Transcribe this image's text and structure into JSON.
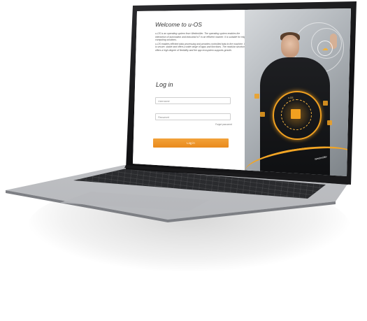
{
  "login_screen": {
    "welcome_title": "Welcome to u-OS",
    "intro_paragraphs": [
      "u-OS is an operating system from Weidmüller. The operating system enables the interaction of automation and industrial IoT in an efficient manner. It is suitable for edge computing solutions.",
      "u-OS enables efficient data processing and provides controlled data to the machine. It is secure, stable and offers a wide range of apps and functions. The modular structure offers a high degree of flexibility and the app ecosystem supports growth."
    ],
    "login_heading": "Log in",
    "username_placeholder": "Username",
    "password_placeholder": "Password",
    "forgot_password_label": "Forgot password",
    "login_button_label": "Log in"
  },
  "hero_image": {
    "ring_label": "u-OS",
    "caption": "Weidmüller",
    "icons": [
      "cloud-icon",
      "chip-icon"
    ]
  },
  "colors": {
    "accent": "#e98a1c",
    "text": "#333333",
    "lid": "#111113",
    "deck": "#c7c8cb"
  }
}
